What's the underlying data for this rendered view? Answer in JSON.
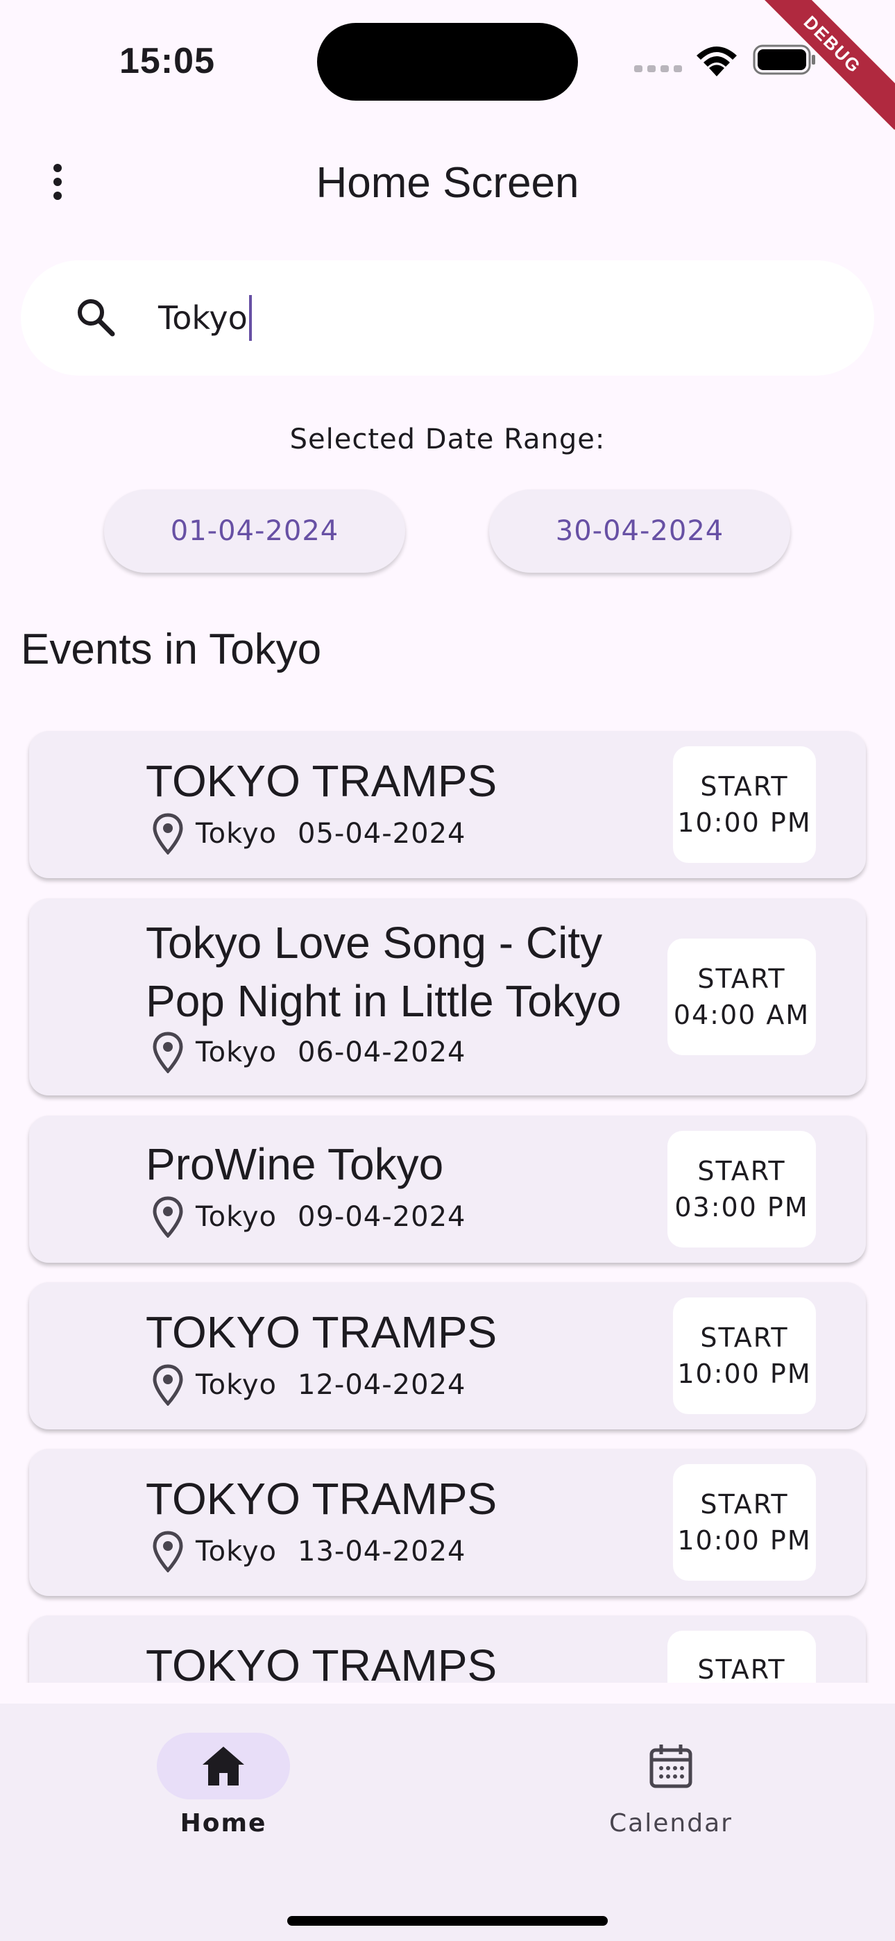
{
  "status_bar": {
    "time": "15:05",
    "debug_label": "DEBUG"
  },
  "app_bar": {
    "title": "Home Screen"
  },
  "search": {
    "value": "Tokyo"
  },
  "date_range": {
    "label": "Selected Date Range:",
    "start": "01-04-2024",
    "end": "30-04-2024"
  },
  "section_title": "Events in Tokyo",
  "events": [
    {
      "title": "TOKYO TRAMPS",
      "location": "Tokyo",
      "date": "05-04-2024",
      "start_label": "START",
      "time": "10:00 PM"
    },
    {
      "title": "Tokyo Love Song - City Pop Night in Little Tokyo",
      "location": "Tokyo",
      "date": "06-04-2024",
      "start_label": "START",
      "time": "04:00 AM"
    },
    {
      "title": "ProWine Tokyo",
      "location": "Tokyo",
      "date": "09-04-2024",
      "start_label": "START",
      "time": "03:00 PM"
    },
    {
      "title": "TOKYO TRAMPS",
      "location": "Tokyo",
      "date": "12-04-2024",
      "start_label": "START",
      "time": "10:00 PM"
    },
    {
      "title": "TOKYO TRAMPS",
      "location": "Tokyo",
      "date": "13-04-2024",
      "start_label": "START",
      "time": "10:00 PM"
    },
    {
      "title": "TOKYO TRAMPS",
      "location": "",
      "date": "",
      "start_label": "START",
      "time": ""
    }
  ],
  "bottom_nav": {
    "items": [
      {
        "label": "Home",
        "icon": "home-icon",
        "active": true
      },
      {
        "label": "Calendar",
        "icon": "calendar-icon",
        "active": false
      }
    ]
  },
  "colors": {
    "background": "#FEF7FF",
    "accent": "#6750A4",
    "card": "#F3EDF7",
    "nav_active": "#E8DEF8",
    "debug": "#B0293F"
  }
}
